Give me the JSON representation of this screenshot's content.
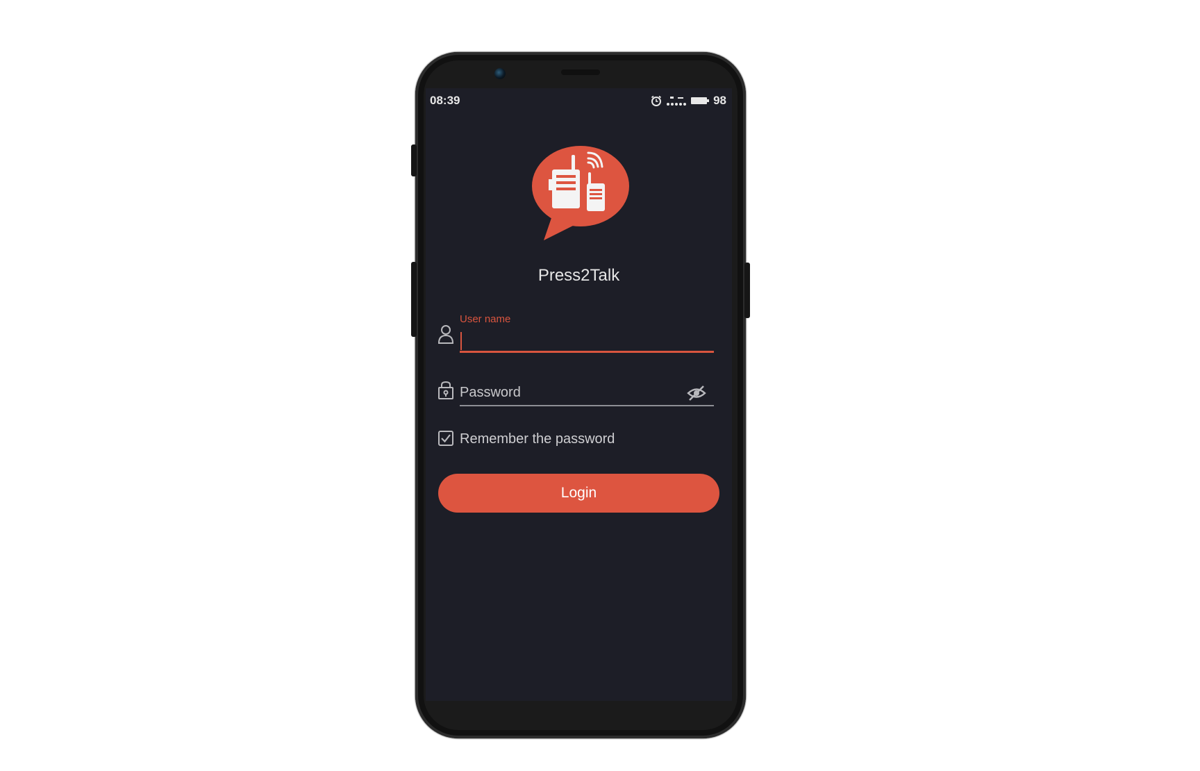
{
  "status_bar": {
    "time": "08:39",
    "battery": "98",
    "icons": [
      "alarm-icon",
      "signal-icon",
      "battery-icon"
    ]
  },
  "app": {
    "name": "Press2Talk",
    "logo": "walkie-talkie-chat-logo"
  },
  "login_form": {
    "username_label": "User name",
    "username_value": "",
    "password_placeholder": "Password",
    "password_value": "",
    "remember_label": "Remember the password",
    "remember_checked": true,
    "login_button": "Login"
  },
  "colors": {
    "accent": "#dd5540",
    "background": "#1d1e27",
    "text": "#e6e6e6"
  }
}
